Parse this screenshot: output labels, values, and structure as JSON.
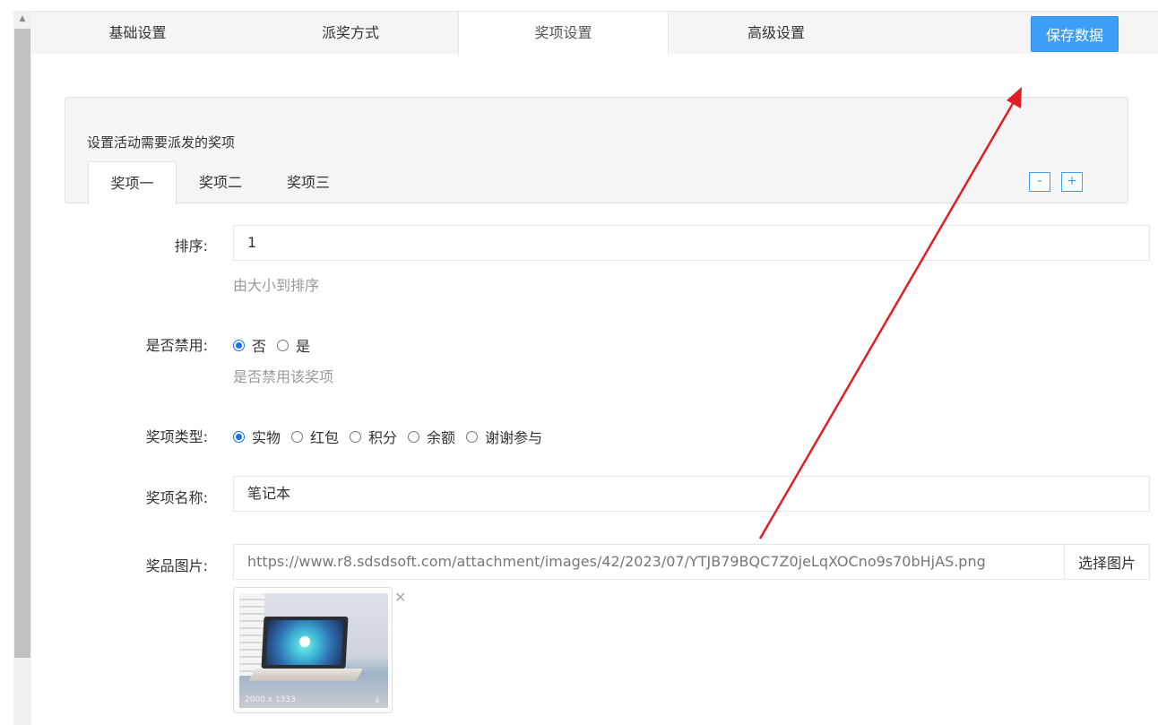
{
  "tabs": [
    {
      "label": "基础设置"
    },
    {
      "label": "派奖方式"
    },
    {
      "label": "奖项设置"
    },
    {
      "label": "高级设置"
    }
  ],
  "save_label": "保存数据",
  "panel": {
    "description": "设置活动需要派发的奖项",
    "prize_tabs": [
      {
        "label": "奖项一"
      },
      {
        "label": "奖项二"
      },
      {
        "label": "奖项三"
      }
    ],
    "minus_label": "-",
    "plus_label": "+"
  },
  "form": {
    "sort": {
      "label": "排序:",
      "value": "1",
      "hint": "由大小到排序"
    },
    "disabled": {
      "label": "是否禁用:",
      "options": [
        "否",
        "是"
      ],
      "selected": "否",
      "hint": "是否禁用该奖项"
    },
    "prize_type": {
      "label": "奖项类型:",
      "options": [
        "实物",
        "红包",
        "积分",
        "余额",
        "谢谢参与"
      ],
      "selected": "实物"
    },
    "prize_name": {
      "label": "奖项名称:",
      "value": "笔记本"
    },
    "prize_image": {
      "label": "奖品图片:",
      "url": "https://www.r8.sdsdsoft.com/attachment/images/42/2023/07/YTJB79BQC7Z0jeLqXOCno9s70bHjAS.png",
      "choose_label": "选择图片",
      "thumb_caption": "2000 x 1333"
    }
  },
  "colors": {
    "accent": "#3a9ff5",
    "arrow": "#e01f25"
  }
}
